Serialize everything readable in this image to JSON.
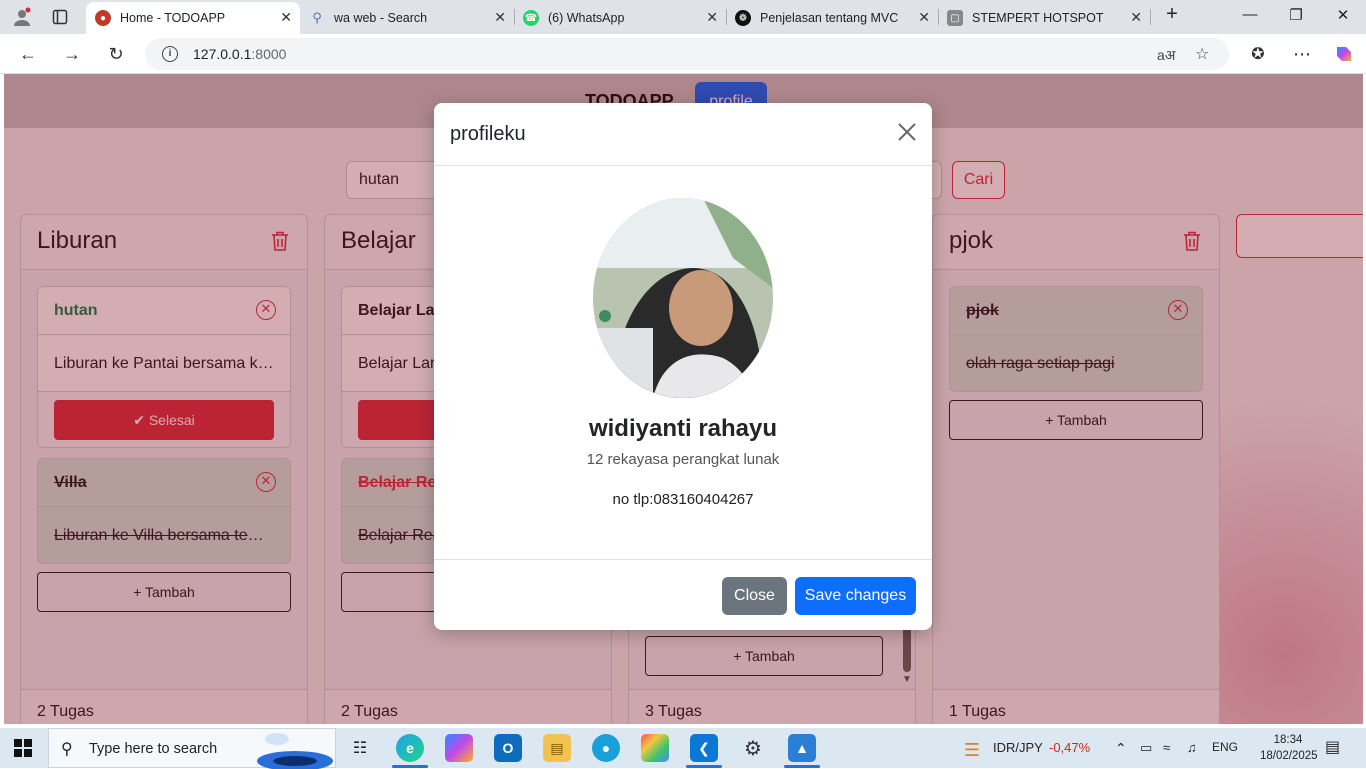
{
  "browser": {
    "tabs": [
      {
        "title": "Home - TODOAPP",
        "active": true
      },
      {
        "title": "wa web - Search",
        "active": false
      },
      {
        "title": "(6) WhatsApp",
        "active": false
      },
      {
        "title": "Penjelasan tentang MVC",
        "active": false
      },
      {
        "title": "STEMPERT HOTSPOT",
        "active": false
      }
    ],
    "url_host": "127.0.0.1",
    "url_port": ":8000"
  },
  "page": {
    "brand": "TODOAPP",
    "profile_button": "profile",
    "search_value": "hutan",
    "search_button": "Cari",
    "lists": [
      {
        "title": "Liburan",
        "cards": [
          {
            "title": "hutan",
            "body": "Liburan ke Pantai bersama ke...",
            "done": false,
            "action": "Selesai"
          },
          {
            "title": "Villa",
            "body": "Liburan ke Villa bersama tem...",
            "done": true
          }
        ],
        "add_label": "Tambah",
        "count": "2 Tugas"
      },
      {
        "title": "Belajar",
        "cards": [
          {
            "title": "Belajar Lar",
            "body": "Belajar Lara",
            "done": false
          },
          {
            "title": "Belajar Re",
            "body": "Belajar Rea",
            "done": true
          }
        ],
        "add_label": "Tambah",
        "count": "2 Tugas"
      },
      {
        "title": "",
        "cards": [],
        "add_label": "Tambah",
        "count": "3 Tugas"
      },
      {
        "title": "pjok",
        "cards": [
          {
            "title": "pjok",
            "body": "olah raga setiap pagi",
            "done": true
          }
        ],
        "add_label": "Tambah",
        "count": "1 Tugas"
      }
    ]
  },
  "modal": {
    "title": "profileku",
    "name": "widiyanti rahayu",
    "class": "12 rekayasa perangkat lunak",
    "phone": "no tlp:083160404267",
    "close_label": "Close",
    "save_label": "Save changes"
  },
  "taskbar": {
    "search_placeholder": "Type here to search",
    "ticker": "IDR/JPY",
    "ticker_change": "-0,47%",
    "lang": "ENG",
    "time": "18:34",
    "date": "18/02/2025"
  },
  "colors": {
    "primary": "#0d6efd",
    "danger": "#dc3545",
    "success": "#198754",
    "secondary": "#6c757d"
  }
}
